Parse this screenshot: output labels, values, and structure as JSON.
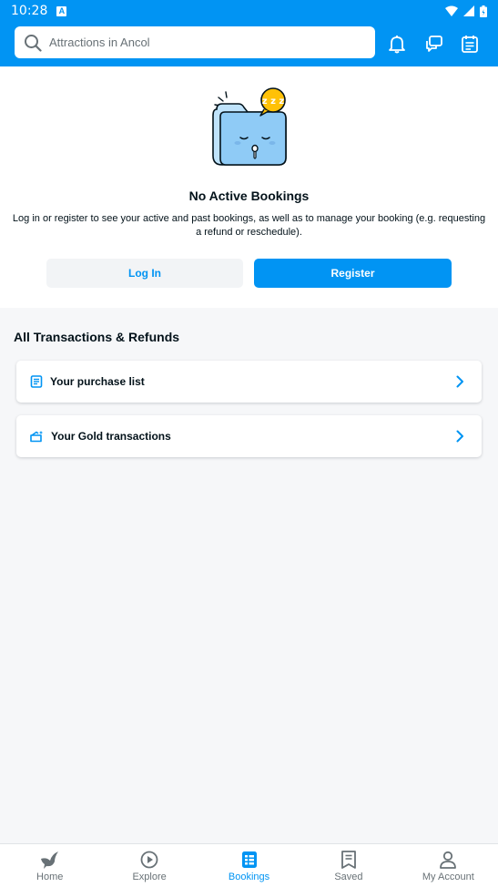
{
  "status": {
    "time": "10:28",
    "badge": "A"
  },
  "search": {
    "placeholder": "Attractions in Ancol"
  },
  "empty_state": {
    "title": "No Active Bookings",
    "description": "Log in or register to see your active and past bookings, as well as to manage your booking (e.g. requesting a refund or reschedule).",
    "login_label": "Log In",
    "register_label": "Register",
    "sleep_text": "z z z"
  },
  "transactions": {
    "title": "All Transactions & Refunds",
    "items": [
      {
        "label": "Your purchase list",
        "icon": "receipt-icon"
      },
      {
        "label": "Your Gold transactions",
        "icon": "gold-wallet-icon"
      }
    ]
  },
  "nav": {
    "items": [
      {
        "label": "Home",
        "icon": "bird-icon",
        "active": false
      },
      {
        "label": "Explore",
        "icon": "play-circle-icon",
        "active": false
      },
      {
        "label": "Bookings",
        "icon": "bookings-icon",
        "active": true
      },
      {
        "label": "Saved",
        "icon": "bookmark-list-icon",
        "active": false
      },
      {
        "label": "My Account",
        "icon": "person-icon",
        "active": false
      }
    ]
  },
  "colors": {
    "primary": "#0194f3",
    "text": "#03121a",
    "muted": "#687176",
    "background": "#f6f7f9",
    "accent_yellow": "#ffc107"
  }
}
